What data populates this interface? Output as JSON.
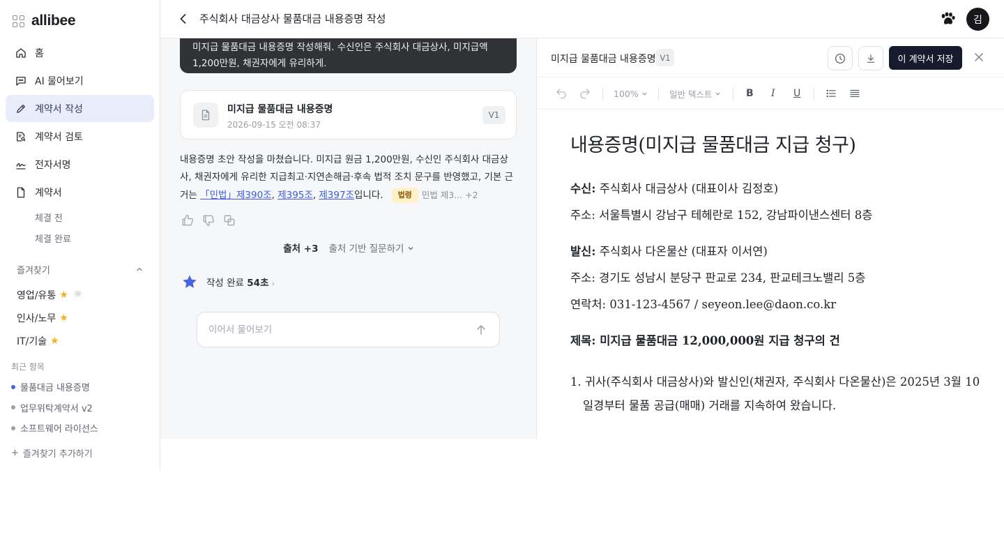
{
  "sidebar": {
    "brand": "allibee",
    "nav": [
      {
        "label": "홈",
        "icon": "home-icon"
      },
      {
        "label": "AI 물어보기",
        "icon": "chat-icon"
      },
      {
        "label": "계약서 작성",
        "icon": "pencil-icon",
        "active": true
      },
      {
        "label": "계약서 검토",
        "icon": "document-search-icon"
      },
      {
        "label": "전자서명",
        "icon": "signature-icon"
      },
      {
        "label": "계약서",
        "icon": "file-icon"
      }
    ],
    "sub": [
      "체결 전",
      "체결 완료"
    ],
    "favorites_title": "즐겨찾기",
    "favorites": [
      "영업/유통",
      "인사/노무",
      "IT/기술"
    ],
    "recent_title": "최근 항목",
    "recent": [
      "물품대금 내용증명",
      "업무위탁계약서 v2",
      "소프트웨어 라이선스"
    ],
    "add_favorite": "즐겨찾기 추가하기"
  },
  "topbar": {
    "title": "주식회사 대금상사 물품대금 내용증명 작성",
    "avatar": "김"
  },
  "chat": {
    "user_message": "미지급 물품대금 내용증명 작성해줘. 수신인은 주식회사 대금상사, 미지급액 1,200만원, 채권자에게 유리하게.",
    "doc_card": {
      "name": "미지급 물품대금 내용증명",
      "date": "2026-09-15 오전 08:37",
      "version": "V1"
    },
    "answer_text": "내용증명 초안 작성을 마쳤습니다. 미지급 원금 1,200만원, 수신인 주식회사 대금상사, 채권자에게 유리한 지급최고·지연손해금·후속 법적 조치 문구를 반영했고, 기본 근거는 ",
    "link1": "「민법」제390조",
    "link2": "제395조",
    "link3": "제397조",
    "sep": ", ",
    "answer_suffix": "입니다.",
    "badge": "법령",
    "badge_rest": "민법 제3...  +2",
    "sources_label": "출처 +3",
    "sources_ask": "출처 기반 질문하기",
    "steps_prefix": "작성 완료",
    "steps_count": "54초",
    "input_placeholder": "이어서 물어보기"
  },
  "editor": {
    "title": "미지급 물품대금 내용증명",
    "version": "V1",
    "save_label": "이 계약서 저장",
    "zoom": "100%",
    "text_style": "일반 텍스트",
    "doc": {
      "heading": "내용증명(미지급 물품대금 지급 청구)",
      "recipient_label": "수신:",
      "recipient": "주식회사 대금상사 (대표이사 김정호)",
      "recipient_addr": "주소: 서울특별시 강남구 테헤란로 152, 강남파이낸스센터 8층",
      "sender_label": "발신:",
      "sender": "주식회사 다온물산 (대표자 이서연)",
      "sender_addr": "주소: 경기도 성남시 분당구 판교로 234, 판교테크노밸리 5층",
      "sender_contact": "연락처: 031-123-4567 / seyeon.lee@daon.co.kr",
      "subject": "제목: 미지급 물품대금 12,000,000원 지급 청구의 건",
      "para1": "1. 귀사(주식회사 대금상사)와 발신인(채권자, 주식회사 다온물산)은 2025년 3월 10일경부터 물품 공급(매매) 거래를 지속하여 왔습니다."
    }
  },
  "colors": {
    "accent": "#4862e4",
    "active_bg": "#e9ecfb",
    "save_bg": "#151a2c",
    "star": "#f2b21b"
  }
}
